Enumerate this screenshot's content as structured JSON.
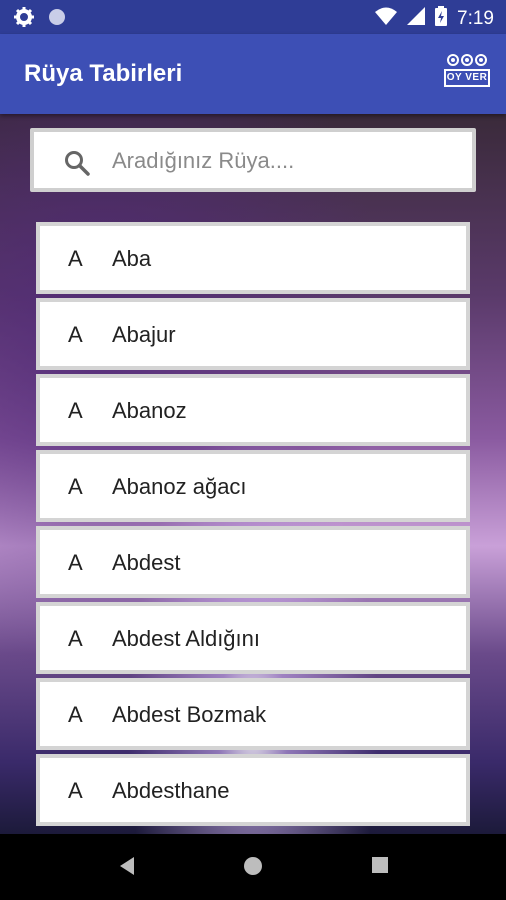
{
  "status_bar": {
    "time": "7:19"
  },
  "app_bar": {
    "title": "Rüya Tabirleri",
    "vote_label": "OY VER"
  },
  "search": {
    "placeholder": "Aradığınız Rüya...."
  },
  "list": {
    "items": [
      {
        "letter": "A",
        "word": "Aba"
      },
      {
        "letter": "A",
        "word": "Abajur"
      },
      {
        "letter": "A",
        "word": "Abanoz"
      },
      {
        "letter": "A",
        "word": "Abanoz ağacı"
      },
      {
        "letter": "A",
        "word": "Abdest"
      },
      {
        "letter": "A",
        "word": "Abdest Aldığını"
      },
      {
        "letter": "A",
        "word": "Abdest Bozmak"
      },
      {
        "letter": "A",
        "word": "Abdesthane"
      }
    ]
  },
  "colors": {
    "status_bar": "#2f3d96",
    "app_bar": "#3d4fb5",
    "nav_bar": "#000000"
  },
  "icons": [
    "gear-icon",
    "circle-icon",
    "wifi-icon",
    "signal-icon",
    "battery-icon",
    "search-icon",
    "vote-icon",
    "back-icon",
    "home-icon",
    "recents-icon"
  ]
}
